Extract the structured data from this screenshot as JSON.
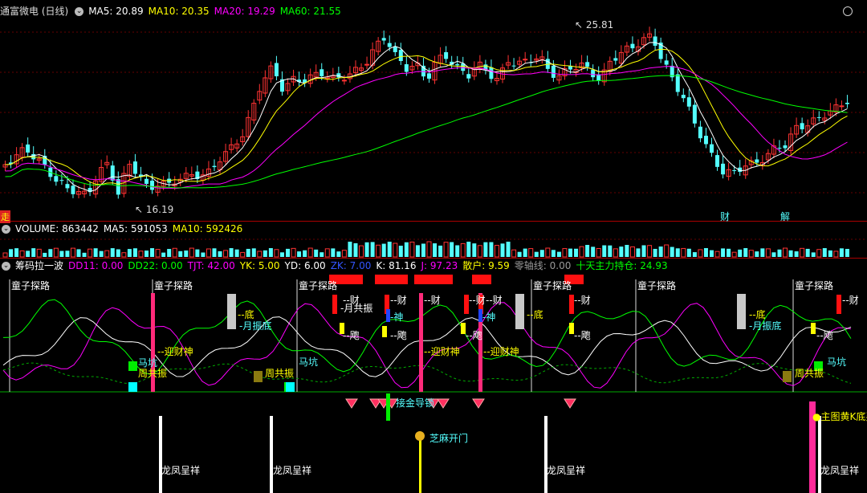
{
  "main": {
    "title": "通富微电 (日线)",
    "ma5_label": "MA5: 20.89",
    "ma10_label": "MA10: 20.35",
    "ma20_label": "MA20: 19.29",
    "ma60_label": "MA60: 21.55",
    "high_label": "25.81",
    "low_label": "16.19",
    "left_tag": "走",
    "tag_cai": "财",
    "tag_jie": "解",
    "colors": {
      "ma5": "#ffffff",
      "ma10": "#ffff00",
      "ma20": "#ff00ff",
      "ma60": "#00ff00",
      "up": "#ff3333",
      "down": "#54ffff"
    }
  },
  "volume": {
    "name": "VOLUME: 863442",
    "ma5_label": "MA5: 591053",
    "ma10_label": "MA10: 592426"
  },
  "indicator": {
    "name": "筹码拉一波",
    "params": [
      {
        "text": "DD11: 0.00",
        "color": "#ff00ff"
      },
      {
        "text": "DD22: 0.00",
        "color": "#00ff00"
      },
      {
        "text": "TJT: 42.00",
        "color": "#ff00ff"
      },
      {
        "text": "YK: 5.00",
        "color": "#ffff00"
      },
      {
        "text": "YD: 6.00",
        "color": "#ffffff"
      },
      {
        "text": "ZK: 7.00",
        "color": "#3355ff"
      },
      {
        "text": "K: 81.16",
        "color": "#ffffff"
      },
      {
        "text": "J: 97.23",
        "color": "#ff00ff"
      },
      {
        "text": "散户: 9.59",
        "color": "#ffff00"
      },
      {
        "text": "零轴线: 0.00",
        "color": "#999999"
      },
      {
        "text": "十天主力持仓: 24.93",
        "color": "#00ff00"
      }
    ],
    "labels": {
      "tongzi": "童子探路",
      "cai": "财",
      "di": "底",
      "yuezhendi": "月振底",
      "yueguzhen": "月共振",
      "fei": "飑",
      "shen": "神",
      "yingcaishen": "迎财神",
      "makeng": "马坑",
      "zhougongzhen": "周共振",
      "jiedi": "接金导锁",
      "zhimakaimen": "芝麻开门",
      "longfeng": "龙凤呈祥",
      "zhutu": "主图黄K底买"
    }
  }
}
